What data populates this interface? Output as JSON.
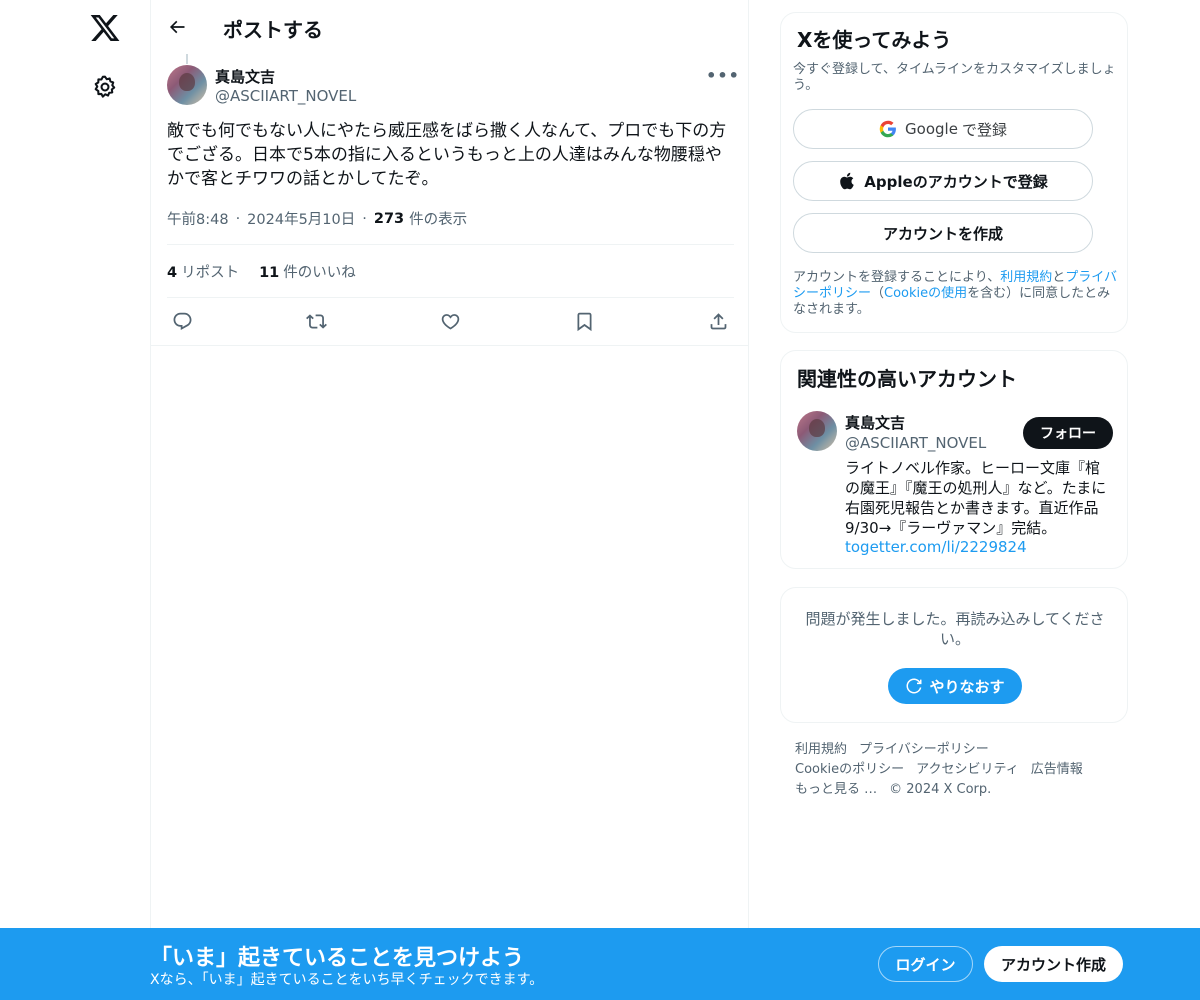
{
  "nav": {
    "logo_icon": "x-logo-icon",
    "settings_icon": "gear-icon"
  },
  "header": {
    "title": "ポストする"
  },
  "tweet": {
    "author_name": "真島文吉",
    "author_handle": "@ASCIIART_NOVEL",
    "text": "敵でも何でもない人にやたら威圧感をばら撒く人なんて、プロでも下の方でござる。日本で5本の指に入るというもっと上の人達はみんな物腰穏やかで客とチワワの話とかしてたぞ。",
    "time": "午前8:48",
    "date": "2024年5月10日",
    "views_count": "273",
    "views_label": "件の表示",
    "reposts_count": "4",
    "reposts_label": "リポスト",
    "likes_count": "11",
    "likes_label": "件のいいね"
  },
  "signup": {
    "title": "Xを使ってみよう",
    "subtitle": "今すぐ登録して、タイムラインをカスタマイズしましょう。",
    "google_label": "Google",
    "google_suffix": "で登録",
    "apple_label": "Appleのアカウントで登録",
    "create_label": "アカウントを作成",
    "legal_pre": "アカウントを登録することにより、",
    "legal_terms": "利用規約",
    "legal_and": "と",
    "legal_privacy": "プライバシーポリシー",
    "legal_mid": "（",
    "legal_cookie": "Cookieの使用",
    "legal_post": "を含む）に同意したとみなされます。"
  },
  "related": {
    "title": "関連性の高いアカウント",
    "name": "真島文吉",
    "handle": "@ASCIIART_NOVEL",
    "follow_label": "フォロー",
    "bio": "ライトノベル作家。ヒーロー文庫『棺の魔王』『魔王の処刑人』など。たまに右園死児報告とか書きます。直近作品9/30→『ラーヴァマン』完結。",
    "link": "togetter.com/li/2229824"
  },
  "error": {
    "message": "問題が発生しました。再読み込みしてください。",
    "retry_label": "やりなおす"
  },
  "footer": {
    "terms": "利用規約",
    "privacy": "プライバシーポリシー",
    "cookie": "Cookieのポリシー",
    "accessibility": "アクセシビリティ",
    "ads": "広告情報",
    "more": "もっと見る …",
    "copyright": "© 2024 X Corp."
  },
  "banner": {
    "title": "「いま」起きていることを見つけよう",
    "subtitle": "Xなら、「いま」起きていることをいち早くチェックできます。",
    "login_label": "ログイン",
    "signup_label": "アカウント作成"
  },
  "colors": {
    "accent": "#1d9bf0",
    "text": "#0f1419",
    "muted": "#536471"
  }
}
